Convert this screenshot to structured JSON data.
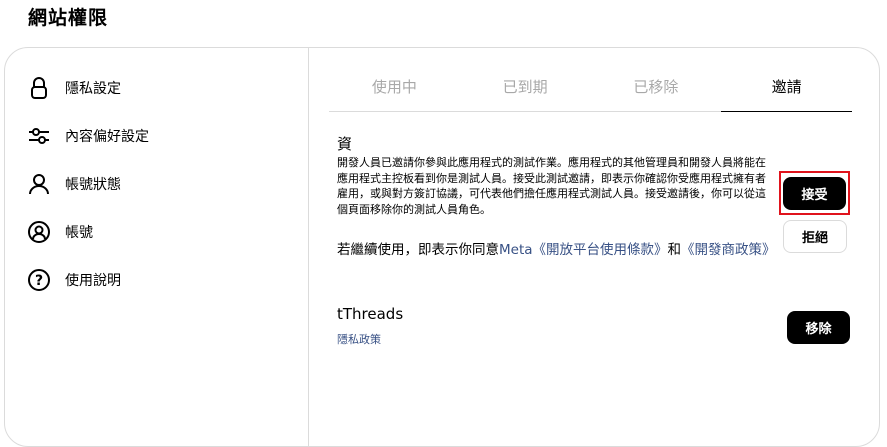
{
  "page": {
    "title": "網站權限"
  },
  "sidebar": {
    "items": [
      {
        "label": "隱私設定",
        "icon": "lock-icon"
      },
      {
        "label": "內容偏好設定",
        "icon": "sliders-icon"
      },
      {
        "label": "帳號狀態",
        "icon": "person-icon"
      },
      {
        "label": "帳號",
        "icon": "account-circle-icon"
      },
      {
        "label": "使用說明",
        "icon": "help-icon"
      }
    ]
  },
  "tabs": [
    {
      "label": "使用中",
      "active": false
    },
    {
      "label": "已到期",
      "active": false
    },
    {
      "label": "已移除",
      "active": false
    },
    {
      "label": "邀請",
      "active": true
    }
  ],
  "invitation": {
    "app_name": "資",
    "description": "開發人員已邀請你參與此應用程式的測試作業。應用程式的其他管理員和開發人員將能在應用程式主控板看到你是測試人員。接受此測試邀請，即表示你確認你受應用程式擁有者雇用，或與對方簽訂協議，可代表他們擔任應用程式測試人員。接受邀請後，你可以從這個頁面移除你的測試人員角色。",
    "terms_prefix": "若繼續使用，即表示你同意",
    "terms_link1": "Meta《開放平台使用條款》",
    "terms_and": "和",
    "terms_link2": "《開發商政策》",
    "accept_label": "接受",
    "decline_label": "拒絕"
  },
  "apps": [
    {
      "name": "tThreads",
      "link": "隱私政策",
      "remove_label": "移除"
    }
  ],
  "colors": {
    "link": "#385185",
    "highlight": "#e0131c",
    "border": "#dbdbdb",
    "inactive_tab": "#a8a8a8"
  }
}
